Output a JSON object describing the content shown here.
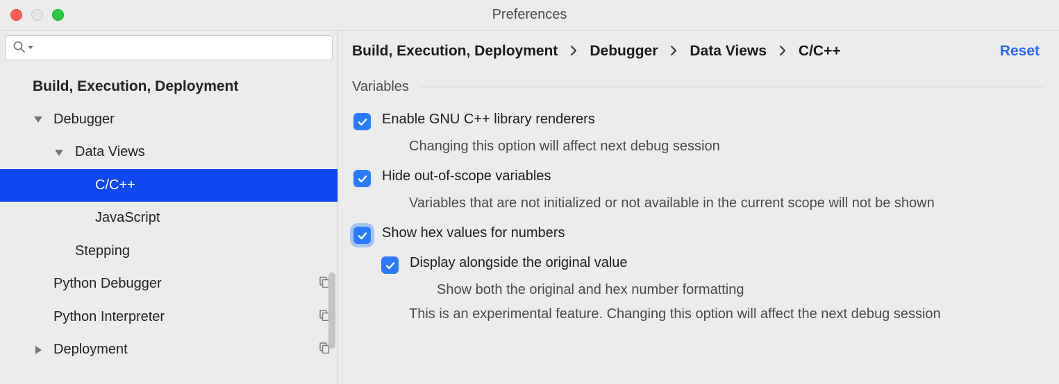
{
  "window": {
    "title": "Preferences"
  },
  "sidebar": {
    "search_placeholder": "",
    "items": [
      {
        "label": "Build, Execution, Deployment"
      },
      {
        "label": "Debugger"
      },
      {
        "label": "Data Views"
      },
      {
        "label": "C/C++"
      },
      {
        "label": "JavaScript"
      },
      {
        "label": "Stepping"
      },
      {
        "label": "Python Debugger"
      },
      {
        "label": "Python Interpreter"
      },
      {
        "label": "Deployment"
      }
    ]
  },
  "breadcrumbs": {
    "items": [
      "Build, Execution, Deployment",
      "Debugger",
      "Data Views",
      "C/C++"
    ],
    "reset": "Reset"
  },
  "section": {
    "title": "Variables"
  },
  "options": {
    "gnu": {
      "label": "Enable GNU C++ library renderers",
      "desc": "Changing this option will affect next debug session",
      "checked": true
    },
    "hide": {
      "label": "Hide out-of-scope variables",
      "desc": "Variables that are not initialized or not available in the current scope will not be shown",
      "checked": true
    },
    "hex": {
      "label": "Show hex values for numbers",
      "checked": true
    },
    "alongside": {
      "label": "Display alongside the original value",
      "desc": "Show both the original and hex number formatting",
      "checked": true
    },
    "note": "This is an experimental feature. Changing this option will affect the next debug session"
  }
}
